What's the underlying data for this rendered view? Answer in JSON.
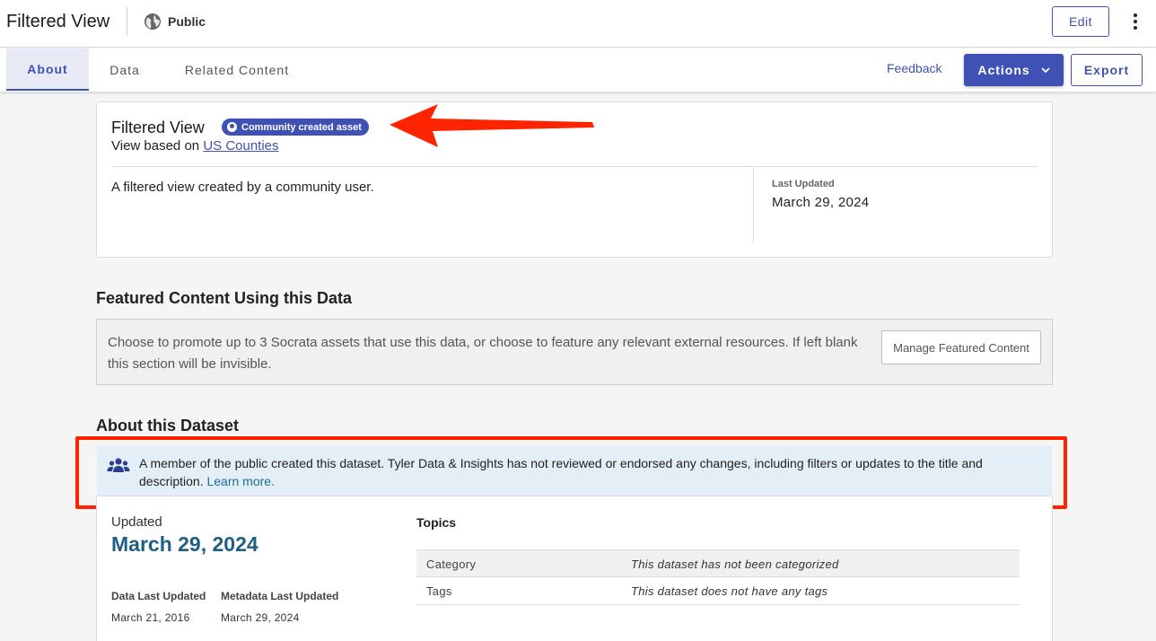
{
  "header": {
    "title": "Filtered View",
    "visibility": "Public",
    "edit_label": "Edit",
    "icons": {
      "visibility": "globe-icon",
      "more": "kebab-menu-icon"
    }
  },
  "tabs": {
    "items": [
      {
        "label": "About",
        "active": true
      },
      {
        "label": "Data",
        "active": false
      },
      {
        "label": "Related Content",
        "active": false
      }
    ],
    "feedback_label": "Feedback",
    "actions_label": "Actions",
    "export_label": "Export"
  },
  "summary": {
    "title": "Filtered View",
    "badge_label": "Community created asset",
    "based_on_prefix": "View based on",
    "based_on_link": "US Counties",
    "description": "A filtered view created by a community user.",
    "last_updated_label": "Last Updated",
    "last_updated_value": "March 29, 2024"
  },
  "featured": {
    "heading": "Featured Content Using this Data",
    "text": "Choose to promote up to 3 Socrata assets that use this data, or choose to feature any relevant external resources. If left blank this section will be invisible.",
    "manage_label": "Manage Featured Content"
  },
  "about": {
    "heading": "About this Dataset",
    "notice_text": "A member of the public created this dataset. Tyler Data & Insights has not reviewed or endorsed any changes, including filters or updates to the title and description.",
    "notice_link": "Learn more.",
    "updated_label": "Updated",
    "updated_value": "March 29, 2024",
    "data_last_updated_label": "Data Last Updated",
    "data_last_updated_value": "March 21, 2016",
    "metadata_last_updated_label": "Metadata Last Updated",
    "metadata_last_updated_value": "March 29, 2024",
    "topics_heading": "Topics",
    "topics": [
      {
        "key": "Category",
        "value": "This dataset has not been categorized"
      },
      {
        "key": "Tags",
        "value": "This dataset does not have any tags"
      }
    ]
  },
  "colors": {
    "accent": "#3f51b5",
    "annotation_red": "#ff2400",
    "notice_bg": "#e3eef7",
    "updated_blue": "#1f5f85"
  }
}
